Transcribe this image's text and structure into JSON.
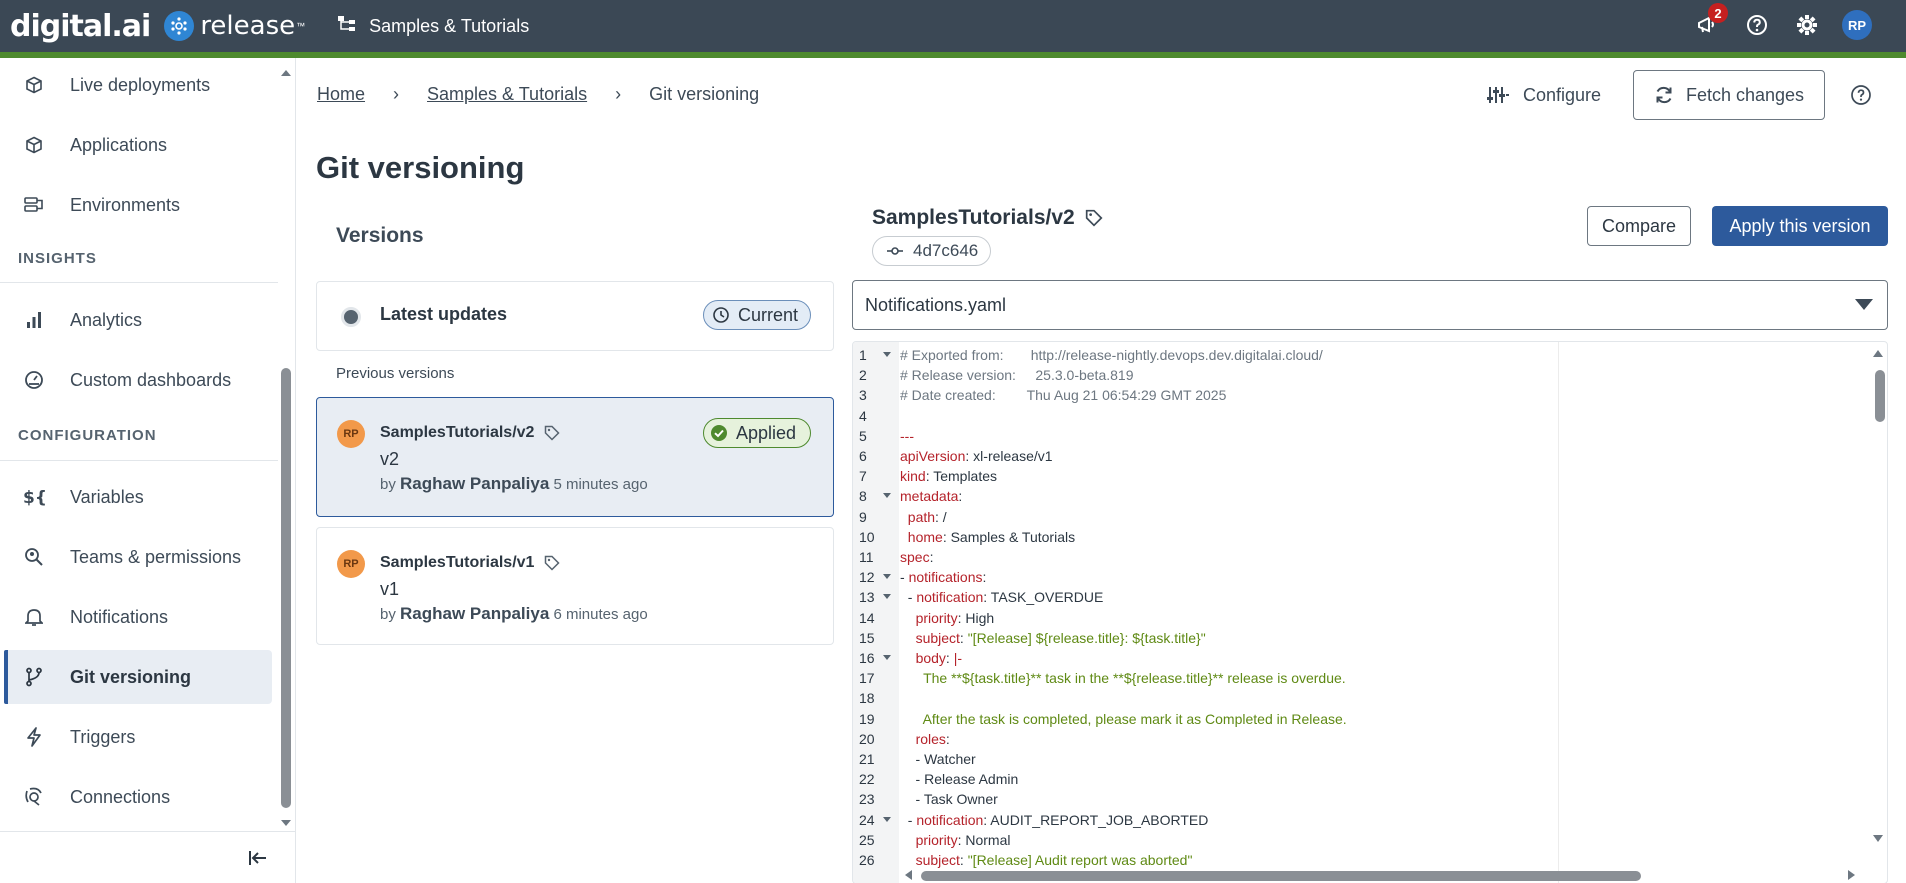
{
  "topbar": {
    "logo_text": "digital.ai",
    "product_text": "release",
    "folder_label": "Samples & Tutorials",
    "notification_count": "2",
    "user_initials": "RP"
  },
  "sidebar": {
    "items_top": [
      {
        "label": "Live deployments",
        "icon": "cube-icon"
      },
      {
        "label": "Applications",
        "icon": "cube-icon"
      },
      {
        "label": "Environments",
        "icon": "server-icon"
      }
    ],
    "insights_header": "INSIGHTS",
    "items_insights": [
      {
        "label": "Analytics",
        "icon": "bar-chart-icon"
      },
      {
        "label": "Custom dashboards",
        "icon": "gauge-icon"
      }
    ],
    "configuration_header": "CONFIGURATION",
    "items_configuration": [
      {
        "label": "Variables",
        "icon": "variable-icon"
      },
      {
        "label": "Teams & permissions",
        "icon": "team-search-icon"
      },
      {
        "label": "Notifications",
        "icon": "bell-icon"
      },
      {
        "label": "Git versioning",
        "icon": "git-branch-icon",
        "active": true
      },
      {
        "label": "Triggers",
        "icon": "lightning-icon"
      },
      {
        "label": "Connections",
        "icon": "connection-icon"
      }
    ]
  },
  "breadcrumb": {
    "home": "Home",
    "folder": "Samples & Tutorials",
    "current": "Git versioning"
  },
  "header_actions": {
    "configure_label": "Configure",
    "fetch_label": "Fetch changes"
  },
  "page": {
    "title": "Git versioning"
  },
  "versions": {
    "title": "Versions",
    "latest_label": "Latest updates",
    "current_badge": "Current",
    "previous_label": "Previous versions",
    "list": [
      {
        "avatar": "RP",
        "name": "SamplesTutorials/v2",
        "short": "v2",
        "by": "by",
        "author": "Raghaw Panpaliya",
        "time": "5 minutes ago",
        "badge": "Applied"
      },
      {
        "avatar": "RP",
        "name": "SamplesTutorials/v1",
        "short": "v1",
        "by": "by",
        "author": "Raghaw Panpaliya",
        "time": "6 minutes ago"
      }
    ]
  },
  "detail": {
    "title": "SamplesTutorials/v2",
    "commit": "4d7c646",
    "compare_label": "Compare",
    "apply_label": "Apply this version",
    "selected_file": "Notifications.yaml"
  },
  "code_lines": [
    {
      "n": "1",
      "fold": true,
      "parts": [
        [
          "c-comment",
          "# Exported from:       http://release-nightly.devops.dev.digitalai.cloud/"
        ]
      ]
    },
    {
      "n": "2",
      "parts": [
        [
          "c-comment",
          "# Release version:     25.3.0-beta.819"
        ]
      ]
    },
    {
      "n": "3",
      "parts": [
        [
          "c-comment",
          "# Date created:        Thu Aug 21 06:54:29 GMT 2025"
        ]
      ]
    },
    {
      "n": "4",
      "parts": []
    },
    {
      "n": "5",
      "parts": [
        [
          "c-key",
          "---"
        ]
      ]
    },
    {
      "n": "6",
      "parts": [
        [
          "c-key",
          "apiVersion"
        ],
        [
          "c-plain",
          ": xl-release/v1"
        ]
      ]
    },
    {
      "n": "7",
      "parts": [
        [
          "c-key",
          "kind"
        ],
        [
          "c-plain",
          ": Templates"
        ]
      ]
    },
    {
      "n": "8",
      "fold": true,
      "parts": [
        [
          "c-key",
          "metadata"
        ],
        [
          "c-plain",
          ":"
        ]
      ]
    },
    {
      "n": "9",
      "parts": [
        [
          "c-plain",
          "  "
        ],
        [
          "c-key",
          "path"
        ],
        [
          "c-plain",
          ": /"
        ]
      ]
    },
    {
      "n": "10",
      "parts": [
        [
          "c-plain",
          "  "
        ],
        [
          "c-key",
          "home"
        ],
        [
          "c-plain",
          ": Samples & Tutorials"
        ]
      ]
    },
    {
      "n": "11",
      "parts": [
        [
          "c-key",
          "spec"
        ],
        [
          "c-plain",
          ":"
        ]
      ]
    },
    {
      "n": "12",
      "fold": true,
      "parts": [
        [
          "c-plain",
          "- "
        ],
        [
          "c-key",
          "notifications"
        ],
        [
          "c-plain",
          ":"
        ]
      ]
    },
    {
      "n": "13",
      "fold": true,
      "parts": [
        [
          "c-plain",
          "  - "
        ],
        [
          "c-key",
          "notification"
        ],
        [
          "c-plain",
          ": TASK_OVERDUE"
        ]
      ]
    },
    {
      "n": "14",
      "parts": [
        [
          "c-plain",
          "    "
        ],
        [
          "c-key",
          "priority"
        ],
        [
          "c-plain",
          ": High"
        ]
      ]
    },
    {
      "n": "15",
      "parts": [
        [
          "c-plain",
          "    "
        ],
        [
          "c-key",
          "subject"
        ],
        [
          "c-plain",
          ": "
        ],
        [
          "c-str",
          "\"[Release] ${release.title}: ${task.title}\""
        ]
      ]
    },
    {
      "n": "16",
      "fold": true,
      "parts": [
        [
          "c-plain",
          "    "
        ],
        [
          "c-key",
          "body"
        ],
        [
          "c-plain",
          ": "
        ],
        [
          "c-key",
          "|-"
        ]
      ]
    },
    {
      "n": "17",
      "parts": [
        [
          "c-plain",
          "      "
        ],
        [
          "c-str",
          "The **${task.title}** task in the **${release.title}** release is overdue."
        ]
      ]
    },
    {
      "n": "18",
      "parts": []
    },
    {
      "n": "19",
      "parts": [
        [
          "c-plain",
          "      "
        ],
        [
          "c-str",
          "After the task is completed, please mark it as Completed in Release."
        ]
      ]
    },
    {
      "n": "20",
      "parts": [
        [
          "c-plain",
          "    "
        ],
        [
          "c-key",
          "roles"
        ],
        [
          "c-plain",
          ":"
        ]
      ]
    },
    {
      "n": "21",
      "parts": [
        [
          "c-plain",
          "    - Watcher"
        ]
      ]
    },
    {
      "n": "22",
      "parts": [
        [
          "c-plain",
          "    - Release Admin"
        ]
      ]
    },
    {
      "n": "23",
      "parts": [
        [
          "c-plain",
          "    - Task Owner"
        ]
      ]
    },
    {
      "n": "24",
      "fold": true,
      "parts": [
        [
          "c-plain",
          "  - "
        ],
        [
          "c-key",
          "notification"
        ],
        [
          "c-plain",
          ": AUDIT_REPORT_JOB_ABORTED"
        ]
      ]
    },
    {
      "n": "25",
      "parts": [
        [
          "c-plain",
          "    "
        ],
        [
          "c-key",
          "priority"
        ],
        [
          "c-plain",
          ": Normal"
        ]
      ]
    },
    {
      "n": "26",
      "parts": [
        [
          "c-plain",
          "    "
        ],
        [
          "c-key",
          "subject"
        ],
        [
          "c-plain",
          ": "
        ],
        [
          "c-str",
          "\"[Release] Audit report was aborted\""
        ]
      ]
    }
  ]
}
